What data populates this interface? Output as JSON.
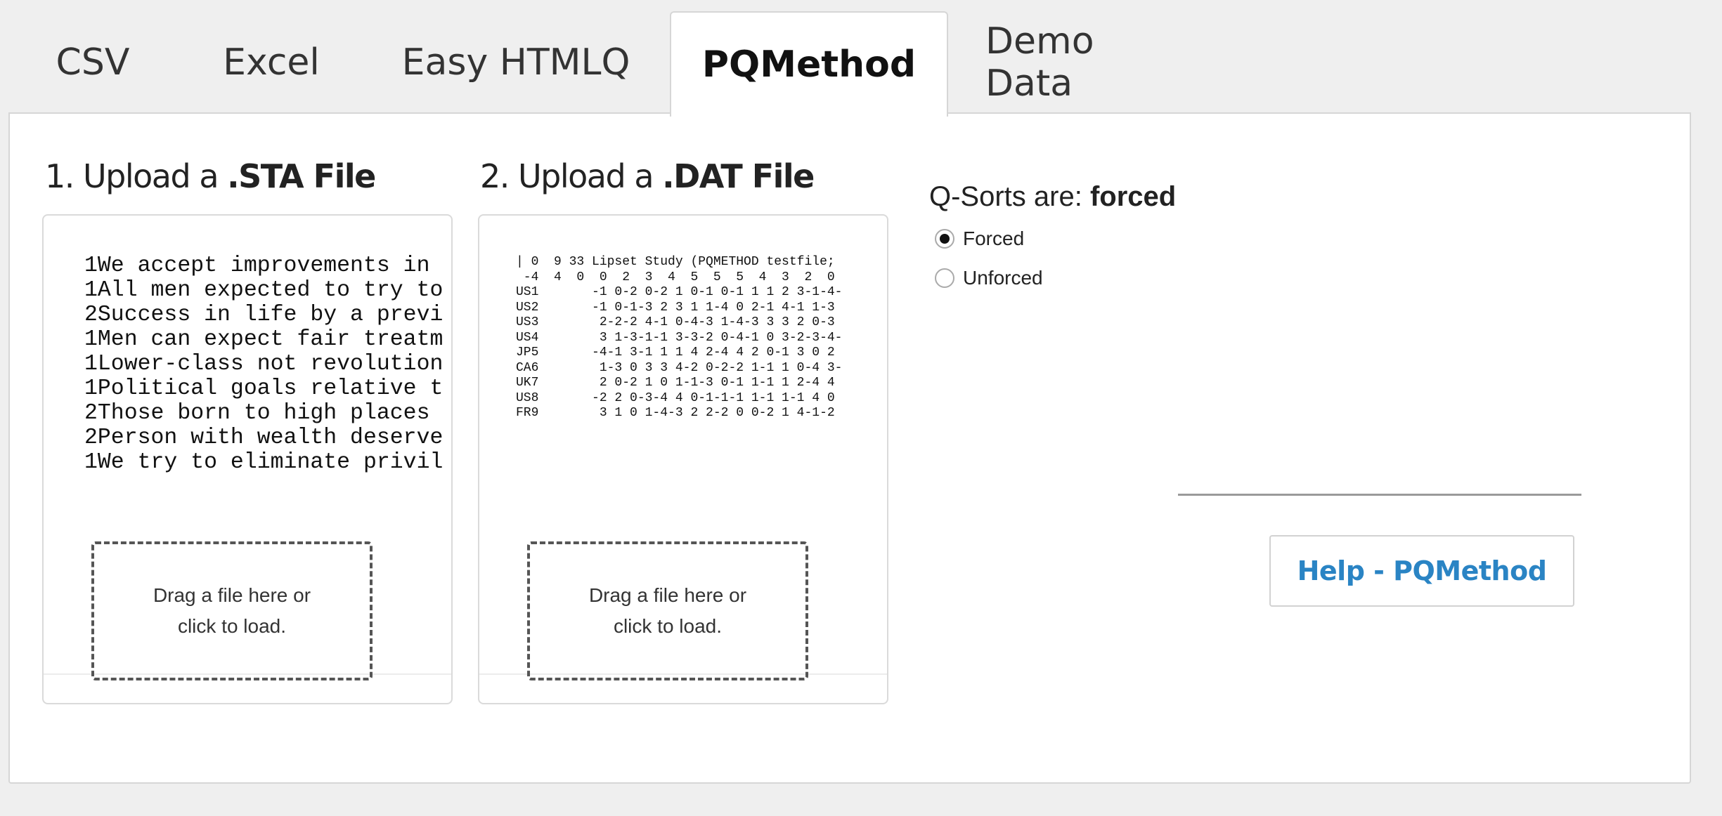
{
  "tabs": [
    {
      "label": "CSV",
      "active": false
    },
    {
      "label": "Excel",
      "active": false
    },
    {
      "label": "Easy HTMLQ",
      "active": false
    },
    {
      "label": "PQMethod",
      "active": true
    },
    {
      "label": "Demo Data",
      "active": false
    }
  ],
  "sta": {
    "title_prefix": "1. Upload a ",
    "title_bold": ".STA File",
    "preview_lines": [
      "1We accept improvements in",
      "1All men expected to try to",
      "2Success in life by a previ",
      "1Men can expect fair treatm",
      "1Lower-class not revolution",
      "1Political goals relative t",
      "2Those born to high places",
      "2Person with wealth deserve",
      "1We try to eliminate privil"
    ],
    "dropzone_line1": "Drag a file here or",
    "dropzone_line2": "click to load."
  },
  "dat": {
    "title_prefix": "2. Upload a ",
    "title_bold": ".DAT File",
    "preview_lines": [
      "| 0  9 33 Lipset Study (PQMETHOD testfile;",
      " -4  4  0  0  2  3  4  5  5  5  4  3  2  0",
      "US1       -1 0-2 0-2 1 0-1 0-1 1 1 2 3-1-4-",
      "US2       -1 0-1-3 2 3 1 1-4 0 2-1 4-1 1-3",
      "US3        2-2-2 4-1 0-4-3 1-4-3 3 3 2 0-3",
      "US4        3 1-3-1-1 3-3-2 0-4-1 0 3-2-3-4-",
      "JP5       -4-1 3-1 1 1 4 2-4 4 2 0-1 3 0 2",
      "CA6        1-3 0 3 3 4-2 0-2-2 1-1 1 0-4 3-",
      "UK7        2 0-2 1 0 1-1-3 0-1 1-1 1 2-4 4",
      "US8       -2 2 0-3-4 4 0-1-1-1 1-1 1-1 4 0",
      "FR9        3 1 0 1-4-3 2 2-2 0 0-2 1 4-1-2"
    ],
    "dropzone_line1": "Drag a file here or",
    "dropzone_line2": "click to load."
  },
  "qsorts": {
    "label_prefix": "Q-Sorts are: ",
    "label_value": "forced",
    "options": [
      {
        "label": "Forced",
        "selected": true
      },
      {
        "label": "Unforced",
        "selected": false
      }
    ]
  },
  "help_button": "Help - PQMethod",
  "colors": {
    "accent": "#2a84c4",
    "background": "#efefef",
    "panel": "#ffffff",
    "border": "#d6d6d6"
  }
}
